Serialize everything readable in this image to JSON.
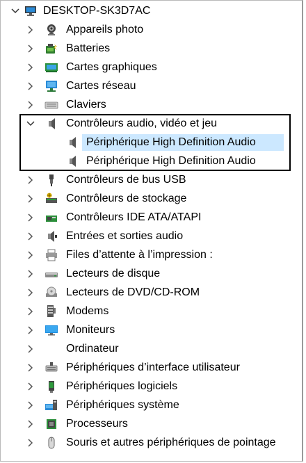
{
  "root": {
    "label": "DESKTOP-SK3D7AC",
    "icon": "computer-icon"
  },
  "categories": [
    {
      "label": "Appareils photo",
      "icon": "camera-icon"
    },
    {
      "label": "Batteries",
      "icon": "battery-icon"
    },
    {
      "label": "Cartes graphiques",
      "icon": "display-adapter-icon"
    },
    {
      "label": "Cartes réseau",
      "icon": "network-adapter-icon"
    },
    {
      "label": "Claviers",
      "icon": "keyboard-icon"
    },
    {
      "label": "Contrôleurs audio, vidéo et jeu",
      "icon": "speaker-icon",
      "expanded": true,
      "children": [
        {
          "label": "Périphérique High Definition Audio",
          "icon": "speaker-icon",
          "selected": true
        },
        {
          "label": "Périphérique High Definition Audio",
          "icon": "speaker-icon"
        }
      ]
    },
    {
      "label": "Contrôleurs de bus USB",
      "icon": "usb-icon"
    },
    {
      "label": "Contrôleurs de stockage",
      "icon": "storage-controller-icon"
    },
    {
      "label": "Contrôleurs IDE ATA/ATAPI",
      "icon": "ide-controller-icon"
    },
    {
      "label": "Entrées et sorties audio",
      "icon": "audio-io-icon"
    },
    {
      "label": "Files d’attente à l’impression :",
      "icon": "printer-icon"
    },
    {
      "label": "Lecteurs de disque",
      "icon": "disk-drive-icon"
    },
    {
      "label": "Lecteurs de DVD/CD-ROM",
      "icon": "dvd-drive-icon"
    },
    {
      "label": "Modems",
      "icon": "modem-icon"
    },
    {
      "label": "Moniteurs",
      "icon": "monitor-icon"
    },
    {
      "label": "Ordinateur",
      "icon": "computer-icon"
    },
    {
      "label": "Périphériques d’interface utilisateur",
      "icon": "hid-icon"
    },
    {
      "label": "Périphériques logiciels",
      "icon": "software-device-icon"
    },
    {
      "label": "Périphériques système",
      "icon": "system-device-icon"
    },
    {
      "label": "Processeurs",
      "icon": "processor-icon"
    },
    {
      "label": "Souris et autres périphériques de pointage",
      "icon": "mouse-icon"
    }
  ],
  "colors": {
    "selection": "#cce8ff",
    "monitor_blue": "#1f8fe0",
    "highlight_border": "#000000"
  }
}
